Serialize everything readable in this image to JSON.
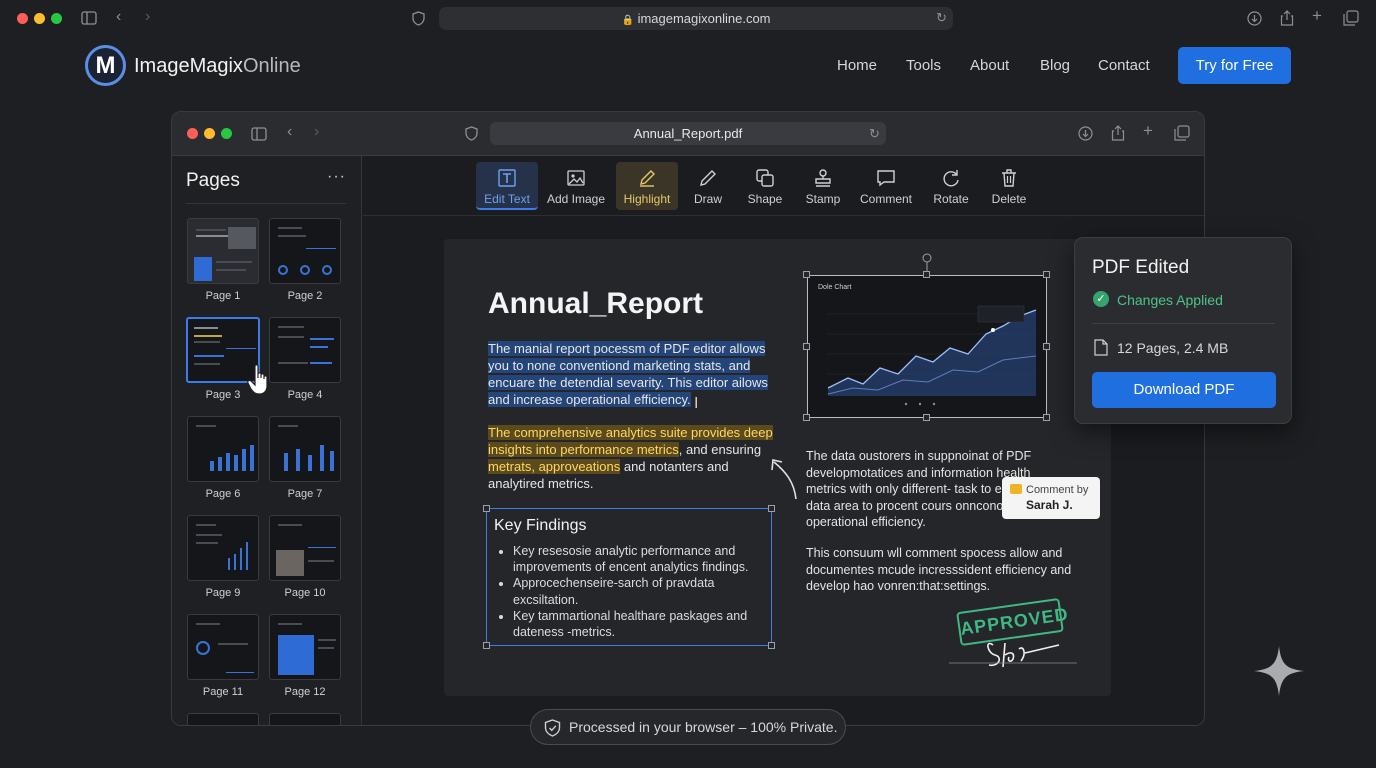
{
  "browser": {
    "url": "imagemagixonline.com"
  },
  "site": {
    "logo_letter": "M",
    "brand_main": "ImageMagix",
    "brand_sub": "Online",
    "nav": [
      "Home",
      "Tools",
      "About",
      "Blog",
      "Contact"
    ],
    "cta": "Try for Free"
  },
  "app": {
    "url": "Annual_Report.pdf",
    "sidebar_title": "Pages",
    "sidebar_more": "···",
    "pages": [
      "Page 1",
      "Page 2",
      "Page 3",
      "Page 4",
      "Page 6",
      "Page 7",
      "Page 9",
      "Page 10",
      "Page 11",
      "Page 12"
    ],
    "selected_page": "Page 3",
    "tools": [
      {
        "label": "Edit Text",
        "icon": "edit-text-icon"
      },
      {
        "label": "Add Image",
        "icon": "image-icon"
      },
      {
        "label": "Highlight",
        "icon": "pen-icon"
      },
      {
        "label": "Draw",
        "icon": "pencil-icon"
      },
      {
        "label": "Shape",
        "icon": "shape-icon"
      },
      {
        "label": "Stamp",
        "icon": "stamp-icon"
      },
      {
        "label": "Comment",
        "icon": "comment-icon"
      },
      {
        "label": "Rotate",
        "icon": "rotate-icon"
      },
      {
        "label": "Delete",
        "icon": "trash-icon"
      }
    ]
  },
  "document": {
    "title": "Annual_Report",
    "para1": "The manial report pocessm of PDF editor allows you to none conventiond marketing stats, and encuare the detendial sevarity. This editor ailows and increase operational efficiency.",
    "para2_hl1": "The comprehensive analytics suite provides deep insights into performance metrics",
    "para2_mid": ", and ensuring ",
    "para2_hl2": "metrats, approveations",
    "para2_end": " and notanters and analytired metrics.",
    "key_findings_title": "Key Findings",
    "key_findings": [
      "Key resesosie analytic performance and improvements of encent analytics findings.",
      "Approcechenseire-sarch of pravdata excsiltation.",
      "Key tammartional healthare paskages and dateness -metrics."
    ],
    "chart_title": "Dole Chart",
    "right_para1": "The data oustorers in suppnoinat of PDF developmotatices and information health metrics with only different- task to ensured data area to procent cours onnconose operational efficiency.",
    "right_para2": "This consuum wll comment spocess allow and documentes mcude incresssident efficiency and develop hao vonren:that:settings.",
    "comment_label": "Comment by",
    "comment_author": "Sarah J.",
    "stamp_text": "APPROVED"
  },
  "card": {
    "title": "PDF Edited",
    "status": "Changes Applied",
    "info": "12 Pages, 2.4 MB",
    "button": "Download PDF"
  },
  "footer": {
    "privacy": "Processed in your browser – 100% Private."
  },
  "colors": {
    "accent": "#1f6fe0",
    "success": "#4cc38a",
    "highlight": "#ffd766"
  }
}
